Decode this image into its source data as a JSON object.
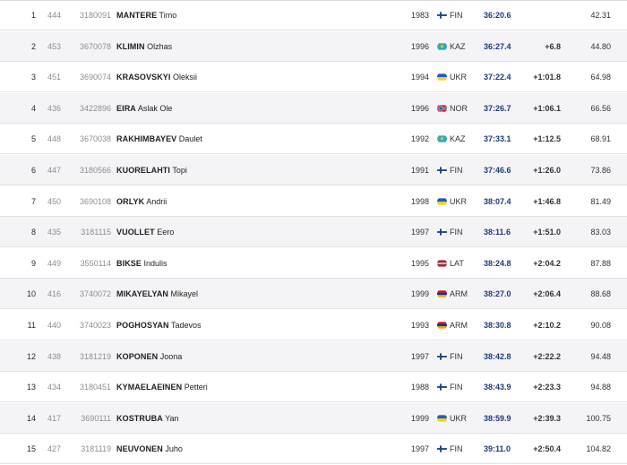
{
  "results": [
    {
      "rank": "1",
      "bib": "444",
      "code": "3180091",
      "surname": "MANTERE",
      "given": "Timo",
      "year": "1983",
      "nation": "FIN",
      "flag": "finland-flag-icon",
      "time": "36:20.6",
      "behind": "",
      "points": "42.31"
    },
    {
      "rank": "2",
      "bib": "453",
      "code": "3670078",
      "surname": "KLIMIN",
      "given": "Olzhas",
      "year": "1996",
      "nation": "KAZ",
      "flag": "kazakhstan-flag-icon",
      "time": "36:27.4",
      "behind": "+6.8",
      "points": "44.80"
    },
    {
      "rank": "3",
      "bib": "451",
      "code": "3690074",
      "surname": "KRASOVSKYI",
      "given": "Oleksii",
      "year": "1994",
      "nation": "UKR",
      "flag": "ukraine-flag-icon",
      "time": "37:22.4",
      "behind": "+1:01.8",
      "points": "64.98"
    },
    {
      "rank": "4",
      "bib": "436",
      "code": "3422896",
      "surname": "EIRA",
      "given": "Aslak Ole",
      "year": "1996",
      "nation": "NOR",
      "flag": "norway-flag-icon",
      "time": "37:26.7",
      "behind": "+1:06.1",
      "points": "66.56"
    },
    {
      "rank": "5",
      "bib": "448",
      "code": "3670038",
      "surname": "RAKHIMBAYEV",
      "given": "Daulet",
      "year": "1992",
      "nation": "KAZ",
      "flag": "kazakhstan-flag-icon",
      "time": "37:33.1",
      "behind": "+1:12.5",
      "points": "68.91"
    },
    {
      "rank": "6",
      "bib": "447",
      "code": "3180566",
      "surname": "KUORELAHTI",
      "given": "Topi",
      "year": "1991",
      "nation": "FIN",
      "flag": "finland-flag-icon",
      "time": "37:46.6",
      "behind": "+1:26.0",
      "points": "73.86"
    },
    {
      "rank": "7",
      "bib": "450",
      "code": "3690108",
      "surname": "ORLYK",
      "given": "Andrii",
      "year": "1998",
      "nation": "UKR",
      "flag": "ukraine-flag-icon",
      "time": "38:07.4",
      "behind": "+1:46.8",
      "points": "81.49"
    },
    {
      "rank": "8",
      "bib": "435",
      "code": "3181115",
      "surname": "VUOLLET",
      "given": "Eero",
      "year": "1997",
      "nation": "FIN",
      "flag": "finland-flag-icon",
      "time": "38:11.6",
      "behind": "+1:51.0",
      "points": "83.03"
    },
    {
      "rank": "9",
      "bib": "449",
      "code": "3550114",
      "surname": "BIKSE",
      "given": "Indulis",
      "year": "1995",
      "nation": "LAT",
      "flag": "latvia-flag-icon",
      "time": "38:24.8",
      "behind": "+2:04.2",
      "points": "87.88"
    },
    {
      "rank": "10",
      "bib": "416",
      "code": "3740072",
      "surname": "MIKAYELYAN",
      "given": "Mikayel",
      "year": "1999",
      "nation": "ARM",
      "flag": "armenia-flag-icon",
      "time": "38:27.0",
      "behind": "+2:06.4",
      "points": "88.68"
    },
    {
      "rank": "11",
      "bib": "440",
      "code": "3740023",
      "surname": "POGHOSYAN",
      "given": "Tadevos",
      "year": "1993",
      "nation": "ARM",
      "flag": "armenia-flag-icon",
      "time": "38:30.8",
      "behind": "+2:10.2",
      "points": "90.08"
    },
    {
      "rank": "12",
      "bib": "438",
      "code": "3181219",
      "surname": "KOPONEN",
      "given": "Joona",
      "year": "1997",
      "nation": "FIN",
      "flag": "finland-flag-icon",
      "time": "38:42.8",
      "behind": "+2:22.2",
      "points": "94.48"
    },
    {
      "rank": "13",
      "bib": "434",
      "code": "3180451",
      "surname": "KYMAELAEINEN",
      "given": "Petteri",
      "year": "1988",
      "nation": "FIN",
      "flag": "finland-flag-icon",
      "time": "38:43.9",
      "behind": "+2:23.3",
      "points": "94.88"
    },
    {
      "rank": "14",
      "bib": "417",
      "code": "3690111",
      "surname": "KOSTRUBA",
      "given": "Yan",
      "year": "1999",
      "nation": "UKR",
      "flag": "ukraine-flag-icon",
      "time": "38:59.9",
      "behind": "+2:39.3",
      "points": "100.75"
    },
    {
      "rank": "15",
      "bib": "427",
      "code": "3181119",
      "surname": "NEUVONEN",
      "given": "Juho",
      "year": "1997",
      "nation": "FIN",
      "flag": "finland-flag-icon",
      "time": "39:11.0",
      "behind": "+2:50.4",
      "points": "104.82"
    }
  ],
  "colors": {
    "time_text": "#1f3a7a",
    "row_alt_bg": "#f4f4f6",
    "muted_text": "#8b8e94"
  }
}
